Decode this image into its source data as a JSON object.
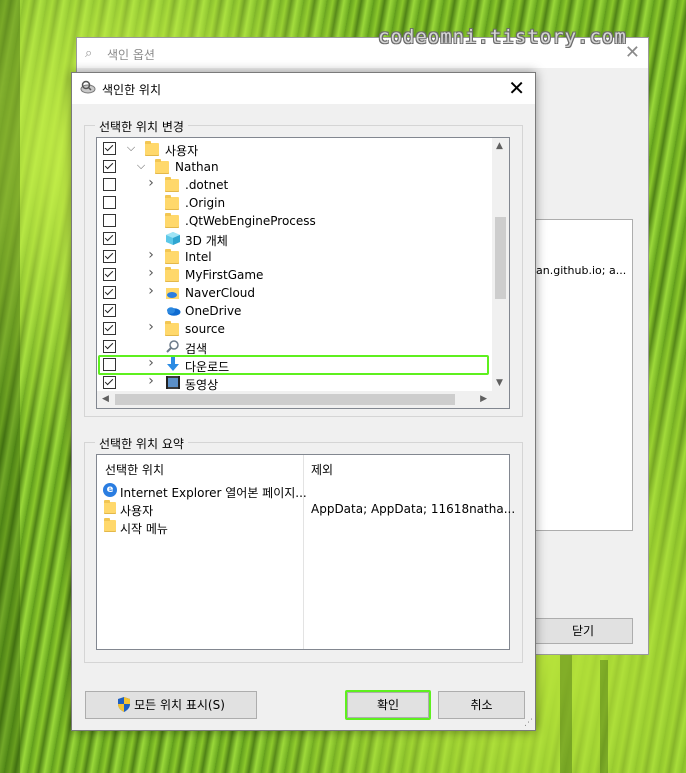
{
  "watermark": "codeomni.tistory.com",
  "background_dialog": {
    "title": "색인 옵션",
    "panel_text": "an.github.io; a...",
    "close_button": "닫기"
  },
  "dialog": {
    "title": "색인한 위치",
    "change_group_label": "선택한 위치 변경",
    "tree_items": [
      {
        "label": "사용자",
        "checked": true,
        "expander": "⌄",
        "icon": "folder-icon",
        "level": 0
      },
      {
        "label": "Nathan",
        "checked": true,
        "expander": "⌄",
        "icon": "folder-icon",
        "level": 1
      },
      {
        "label": ".dotnet",
        "checked": false,
        "expander": "›",
        "icon": "folder-icon",
        "level": 2
      },
      {
        "label": ".Origin",
        "checked": false,
        "expander": "",
        "icon": "folder-icon",
        "level": 2
      },
      {
        "label": ".QtWebEngineProcess",
        "checked": false,
        "expander": "",
        "icon": "folder-icon",
        "level": 2
      },
      {
        "label": "3D 개체",
        "checked": true,
        "expander": "",
        "icon": "3d-objects-icon",
        "level": 2
      },
      {
        "label": "Intel",
        "checked": true,
        "expander": "›",
        "icon": "folder-icon",
        "level": 2
      },
      {
        "label": "MyFirstGame",
        "checked": true,
        "expander": "›",
        "icon": "folder-icon",
        "level": 2
      },
      {
        "label": "NaverCloud",
        "checked": true,
        "expander": "›",
        "icon": "cloud-folder-icon",
        "level": 2
      },
      {
        "label": "OneDrive",
        "checked": true,
        "expander": "",
        "icon": "onedrive-icon",
        "level": 2
      },
      {
        "label": "source",
        "checked": true,
        "expander": "›",
        "icon": "folder-icon",
        "level": 2
      },
      {
        "label": "검색",
        "checked": true,
        "expander": "",
        "icon": "search-icon",
        "level": 2
      },
      {
        "label": "다운로드",
        "checked": false,
        "expander": "›",
        "icon": "download-icon",
        "level": 2,
        "highlighted": true
      },
      {
        "label": "동영상",
        "checked": true,
        "expander": "›",
        "icon": "video-icon",
        "level": 2
      }
    ],
    "summary_group_label": "선택한 위치 요약",
    "summary": {
      "col_location": "선택한 위치",
      "col_exclude": "제외",
      "rows": [
        {
          "location": "Internet Explorer 열어본 페이지...",
          "exclude": "",
          "icon": "ie-icon"
        },
        {
          "location": "사용자",
          "exclude": "AppData; AppData; 11618natha...",
          "icon": "folder-icon"
        },
        {
          "location": "시작 메뉴",
          "exclude": "",
          "icon": "folder-icon"
        }
      ]
    },
    "show_all_button": "모든 위치 표시(S)",
    "ok_button": "확인",
    "cancel_button": "취소"
  },
  "colors": {
    "highlight": "#5ef01e",
    "folder": "#ffd86b"
  }
}
